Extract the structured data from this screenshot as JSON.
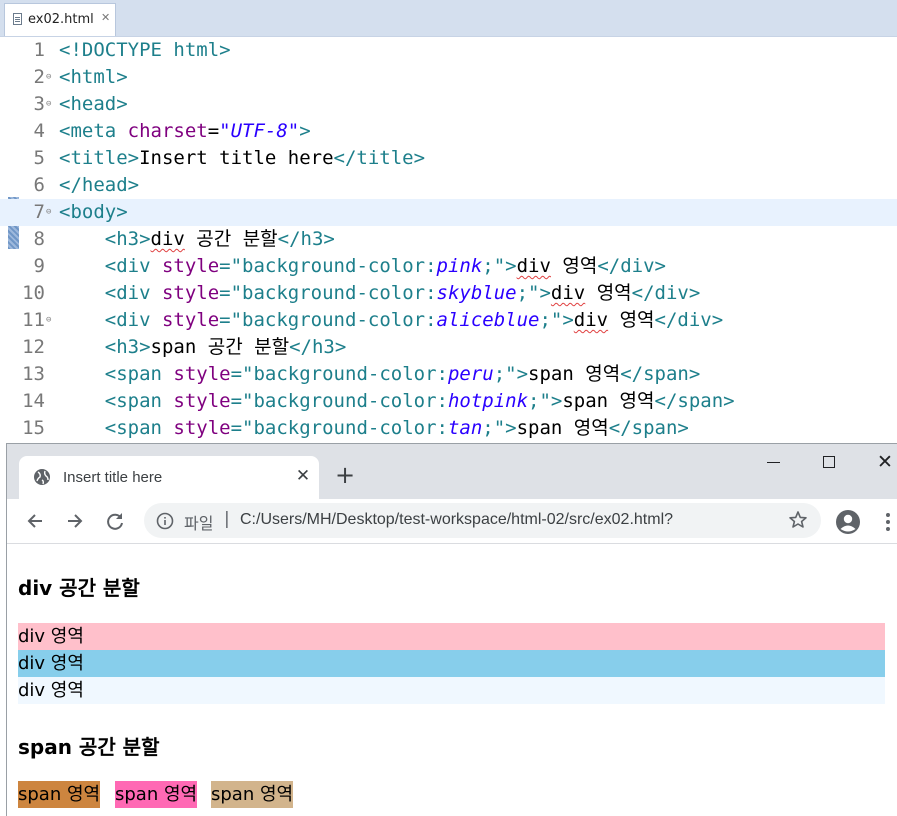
{
  "editor": {
    "tab_label": "ex02.html",
    "tab_close_glyph": "✕",
    "lines": [
      {
        "num": "1",
        "fold": "",
        "current": false,
        "segments": [
          {
            "c": "tag",
            "t": "<!DOCTYPE html>"
          }
        ]
      },
      {
        "num": "2",
        "fold": "⊖",
        "current": false,
        "segments": [
          {
            "c": "tag",
            "t": "<html>"
          }
        ]
      },
      {
        "num": "3",
        "fold": "⊖",
        "current": false,
        "segments": [
          {
            "c": "tag",
            "t": "<head>"
          }
        ]
      },
      {
        "num": "4",
        "fold": "",
        "current": false,
        "segments": [
          {
            "c": "tag",
            "t": "<meta "
          },
          {
            "c": "attr",
            "t": "charset"
          },
          {
            "c": "txt",
            "t": "="
          },
          {
            "c": "val",
            "t": "\"UTF-8\""
          },
          {
            "c": "tag",
            "t": ">"
          }
        ]
      },
      {
        "num": "5",
        "fold": "",
        "current": false,
        "segments": [
          {
            "c": "tag",
            "t": "<title>"
          },
          {
            "c": "txt",
            "t": "Insert title here"
          },
          {
            "c": "tag",
            "t": "</title>"
          }
        ]
      },
      {
        "num": "6",
        "fold": "",
        "current": false,
        "segments": [
          {
            "c": "tag",
            "t": "</head>"
          }
        ]
      },
      {
        "num": "7",
        "fold": "⊖",
        "current": true,
        "segments": [
          {
            "c": "tag",
            "t": "<body>"
          }
        ]
      },
      {
        "num": "8",
        "fold": "",
        "current": false,
        "segments": [
          {
            "c": "txt",
            "t": "    "
          },
          {
            "c": "tag",
            "t": "<h3>"
          },
          {
            "c": "sq",
            "t": "div"
          },
          {
            "c": "txt",
            "t": " 공간 분할"
          },
          {
            "c": "tag",
            "t": "</h3>"
          }
        ]
      },
      {
        "num": "9",
        "fold": "",
        "current": false,
        "segments": [
          {
            "c": "txt",
            "t": "    "
          },
          {
            "c": "tag",
            "t": "<div "
          },
          {
            "c": "attr",
            "t": "style"
          },
          {
            "c": "tag",
            "t": "=\"background-color:"
          },
          {
            "c": "css",
            "t": "pink"
          },
          {
            "c": "tag",
            "t": ";\">"
          },
          {
            "c": "sq",
            "t": "div"
          },
          {
            "c": "txt",
            "t": " 영역"
          },
          {
            "c": "tag",
            "t": "</div>"
          }
        ]
      },
      {
        "num": "10",
        "fold": "",
        "current": false,
        "segments": [
          {
            "c": "txt",
            "t": "    "
          },
          {
            "c": "tag",
            "t": "<div "
          },
          {
            "c": "attr",
            "t": "style"
          },
          {
            "c": "tag",
            "t": "=\"background-color:"
          },
          {
            "c": "css",
            "t": "skyblue"
          },
          {
            "c": "tag",
            "t": ";\">"
          },
          {
            "c": "sq",
            "t": "div"
          },
          {
            "c": "txt",
            "t": " 영역"
          },
          {
            "c": "tag",
            "t": "</div>"
          }
        ]
      },
      {
        "num": "11",
        "fold": "⊖",
        "current": false,
        "segments": [
          {
            "c": "txt",
            "t": "    "
          },
          {
            "c": "tag",
            "t": "<div "
          },
          {
            "c": "attr",
            "t": "style"
          },
          {
            "c": "tag",
            "t": "=\"background-color:"
          },
          {
            "c": "css",
            "t": "aliceblue"
          },
          {
            "c": "tag",
            "t": ";\">"
          },
          {
            "c": "sq",
            "t": "div"
          },
          {
            "c": "txt",
            "t": " 영역"
          },
          {
            "c": "tag",
            "t": "</div>"
          }
        ]
      },
      {
        "num": "12",
        "fold": "",
        "current": false,
        "segments": [
          {
            "c": "txt",
            "t": "    "
          },
          {
            "c": "tag",
            "t": "<h3>"
          },
          {
            "c": "txt",
            "t": "span 공간 분할"
          },
          {
            "c": "tag",
            "t": "</h3>"
          }
        ]
      },
      {
        "num": "13",
        "fold": "",
        "current": false,
        "segments": [
          {
            "c": "txt",
            "t": "    "
          },
          {
            "c": "tag",
            "t": "<span "
          },
          {
            "c": "attr",
            "t": "style"
          },
          {
            "c": "tag",
            "t": "=\"background-color:"
          },
          {
            "c": "css",
            "t": "peru"
          },
          {
            "c": "tag",
            "t": ";\">"
          },
          {
            "c": "txt",
            "t": "span 영역"
          },
          {
            "c": "tag",
            "t": "</span>"
          }
        ]
      },
      {
        "num": "14",
        "fold": "",
        "current": false,
        "segments": [
          {
            "c": "txt",
            "t": "    "
          },
          {
            "c": "tag",
            "t": "<span "
          },
          {
            "c": "attr",
            "t": "style"
          },
          {
            "c": "tag",
            "t": "=\"background-color:"
          },
          {
            "c": "css",
            "t": "hotpink"
          },
          {
            "c": "tag",
            "t": ";\">"
          },
          {
            "c": "txt",
            "t": "span 영역"
          },
          {
            "c": "tag",
            "t": "</span>"
          }
        ]
      },
      {
        "num": "15",
        "fold": "",
        "current": false,
        "segments": [
          {
            "c": "txt",
            "t": "    "
          },
          {
            "c": "tag",
            "t": "<span "
          },
          {
            "c": "attr",
            "t": "style"
          },
          {
            "c": "tag",
            "t": "=\"background-color:"
          },
          {
            "c": "css",
            "t": "tan"
          },
          {
            "c": "tag",
            "t": ";\">"
          },
          {
            "c": "txt",
            "t": "span 영역"
          },
          {
            "c": "tag",
            "t": "</span>"
          }
        ]
      }
    ]
  },
  "browser": {
    "tab_title": "Insert title here",
    "tab_close_glyph": "✕",
    "new_tab_glyph": "+",
    "window_close_glyph": "✕",
    "scheme_label": "파일",
    "url_separator": "|",
    "url": "C:/Users/MH/Desktop/test-workspace/html-02/src/ex02.html?"
  },
  "page": {
    "h3_div": "div 공간 분할",
    "divs": [
      {
        "text": "div 영역",
        "color": "#ffc0cb"
      },
      {
        "text": "div 영역",
        "color": "#87ceeb"
      },
      {
        "text": "div 영역",
        "color": "#f0f8ff"
      }
    ],
    "h3_span": "span 공간 분할",
    "spans": [
      {
        "text": "span 영역",
        "color": "#cd853f"
      },
      {
        "text": "span 영역",
        "color": "#ff69b4"
      },
      {
        "text": "span 영역",
        "color": "#d2b48c"
      }
    ]
  }
}
